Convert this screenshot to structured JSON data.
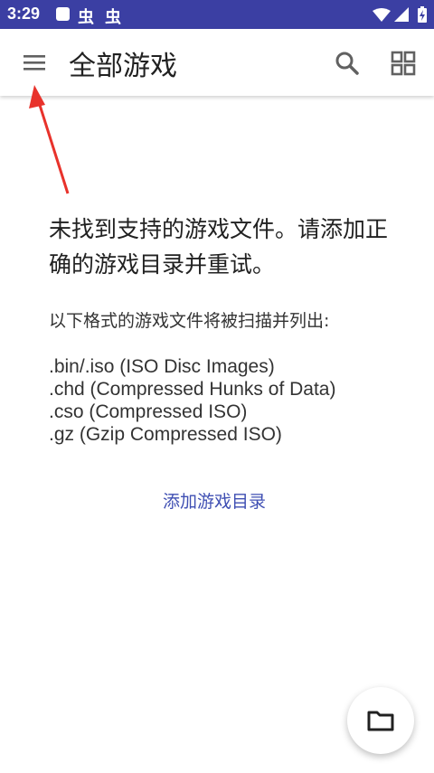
{
  "status_bar": {
    "time": "3:29",
    "app_icon_glyph": "虫",
    "colors": {
      "background": "#3b3fa3"
    }
  },
  "app_bar": {
    "title": "全部游戏",
    "icons": [
      "menu-icon",
      "search-icon",
      "grid-view-icon"
    ]
  },
  "empty_state": {
    "message": "未找到支持的游戏文件。请添加正确的游戏目录并重试。",
    "formats_intro": "以下格式的游戏文件将被扫描并列出:",
    "formats": [
      ".bin/.iso (ISO Disc Images)",
      ".chd (Compressed Hunks of Data)",
      ".cso (Compressed ISO)",
      ".gz (Gzip Compressed ISO)"
    ],
    "add_directory_label": "添加游戏目录"
  },
  "fab": {
    "icon": "folder-icon"
  },
  "colors": {
    "accent": "#3f4fb3",
    "annotation_arrow": "#e8322b"
  }
}
